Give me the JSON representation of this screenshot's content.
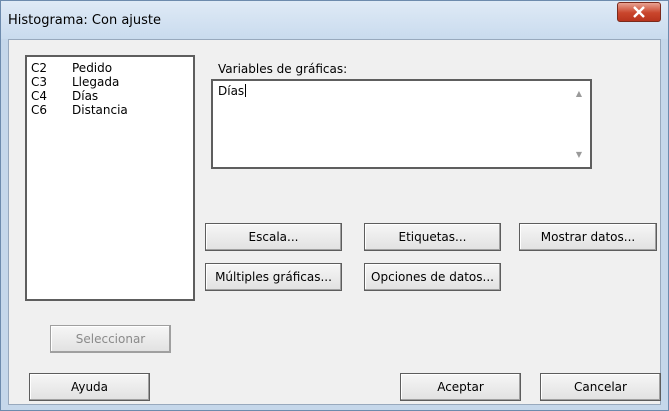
{
  "window": {
    "title": "Histograma: Con ajuste"
  },
  "variables_list": {
    "items": [
      {
        "code": "C2",
        "name": "Pedido"
      },
      {
        "code": "C3",
        "name": "Llegada"
      },
      {
        "code": "C4",
        "name": "Días"
      },
      {
        "code": "C6",
        "name": "Distancia"
      }
    ]
  },
  "graph_variables": {
    "label": "Variables de gráficas:",
    "value": "Días"
  },
  "buttons": {
    "scale": "Escala...",
    "labels": "Etiquetas...",
    "show_data": "Mostrar datos...",
    "multiple_graphs": "Múltiples gráficas...",
    "data_options": "Opciones de datos...",
    "select": "Seleccionar",
    "help": "Ayuda",
    "ok": "Aceptar",
    "cancel": "Cancelar"
  },
  "icons": {
    "close": "close-icon",
    "scroll_up": "scroll-up-icon",
    "scroll_down": "scroll-down-icon"
  }
}
